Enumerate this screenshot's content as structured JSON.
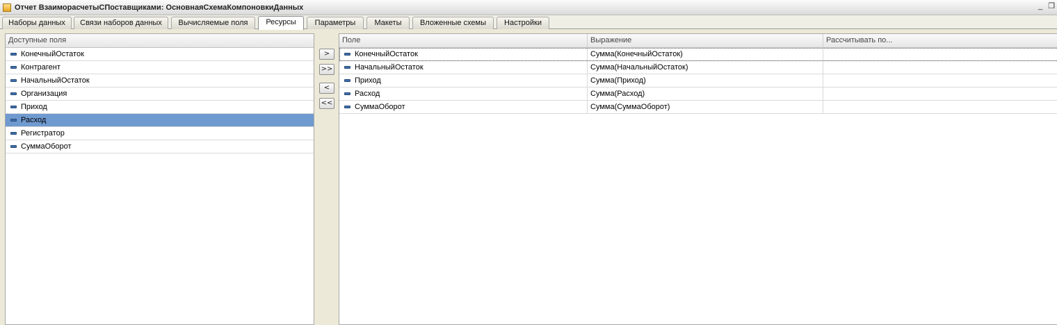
{
  "window": {
    "title": "Отчет ВзаиморасчетыСПоставщиками: ОсновнаяСхемаКомпоновкиДанных",
    "minimize_glyph": "_",
    "restore_glyph": "❐"
  },
  "tabs": [
    {
      "label": "Наборы данных"
    },
    {
      "label": "Связи наборов данных"
    },
    {
      "label": "Вычисляемые поля"
    },
    {
      "label": "Ресурсы",
      "active": true
    },
    {
      "label": "Параметры"
    },
    {
      "label": "Макеты"
    },
    {
      "label": "Вложенные схемы"
    },
    {
      "label": "Настройки"
    }
  ],
  "available_fields": {
    "header": "Доступные поля",
    "items": [
      {
        "label": "КонечныйОстаток"
      },
      {
        "label": "Контрагент"
      },
      {
        "label": "НачальныйОстаток"
      },
      {
        "label": "Организация"
      },
      {
        "label": "Приход"
      },
      {
        "label": "Расход",
        "selected": true
      },
      {
        "label": "Регистратор"
      },
      {
        "label": "СуммаОборот"
      }
    ]
  },
  "mover_buttons": {
    "add": ">",
    "add_all": ">>",
    "remove": "<",
    "remove_all": "<<"
  },
  "resources": {
    "columns": [
      "Поле",
      "Выражение",
      "Рассчитывать по..."
    ],
    "rows": [
      {
        "field": "КонечныйОстаток",
        "expression": "Сумма(КонечныйОстаток)",
        "calc_by": ""
      },
      {
        "field": "НачальныйОстаток",
        "expression": "Сумма(НачальныйОстаток)",
        "calc_by": ""
      },
      {
        "field": "Приход",
        "expression": "Сумма(Приход)",
        "calc_by": ""
      },
      {
        "field": "Расход",
        "expression": "Сумма(Расход)",
        "calc_by": ""
      },
      {
        "field": "СуммаОборот",
        "expression": "Сумма(СуммаОборот)",
        "calc_by": ""
      }
    ]
  },
  "colors": {
    "selection": "#6f9ad0",
    "field_icon": "#3f6ea8"
  }
}
